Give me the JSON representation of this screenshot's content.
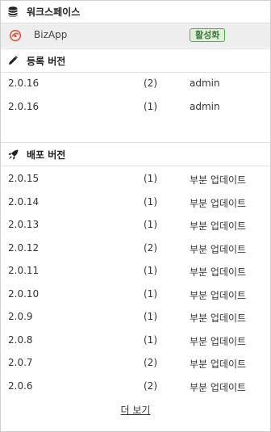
{
  "workspace": {
    "title": "워크스페이스",
    "icon": "database-icon",
    "item": {
      "name": "BizApp",
      "logo": "app-logo-icon",
      "status": "활성화"
    }
  },
  "registered": {
    "title": "등록 버전",
    "icon": "pencil-icon",
    "rows": [
      {
        "version": "2.0.16",
        "count": "(2)",
        "desc": "admin"
      },
      {
        "version": "2.0.16",
        "count": "(1)",
        "desc": "admin"
      }
    ]
  },
  "deployed": {
    "title": "배포 버전",
    "icon": "rocket-icon",
    "rows": [
      {
        "version": "2.0.15",
        "count": "(1)",
        "desc": "부분 업데이트"
      },
      {
        "version": "2.0.14",
        "count": "(1)",
        "desc": "부분 업데이트"
      },
      {
        "version": "2.0.13",
        "count": "(1)",
        "desc": "부분 업데이트"
      },
      {
        "version": "2.0.12",
        "count": "(2)",
        "desc": "부분 업데이트"
      },
      {
        "version": "2.0.11",
        "count": "(1)",
        "desc": "부분 업데이트"
      },
      {
        "version": "2.0.10",
        "count": "(1)",
        "desc": "부분 업데이트"
      },
      {
        "version": "2.0.9",
        "count": "(1)",
        "desc": "부분 업데이트"
      },
      {
        "version": "2.0.8",
        "count": "(1)",
        "desc": "부분 업데이트"
      },
      {
        "version": "2.0.7",
        "count": "(2)",
        "desc": "부분 업데이트"
      },
      {
        "version": "2.0.6",
        "count": "(2)",
        "desc": "부분 업데이트"
      }
    ]
  },
  "more_label": "더 보기",
  "colors": {
    "badge_border": "#4cae4c",
    "badge_bg": "#dff0d8",
    "badge_text": "#3c763d",
    "logo": "#e0553b"
  }
}
